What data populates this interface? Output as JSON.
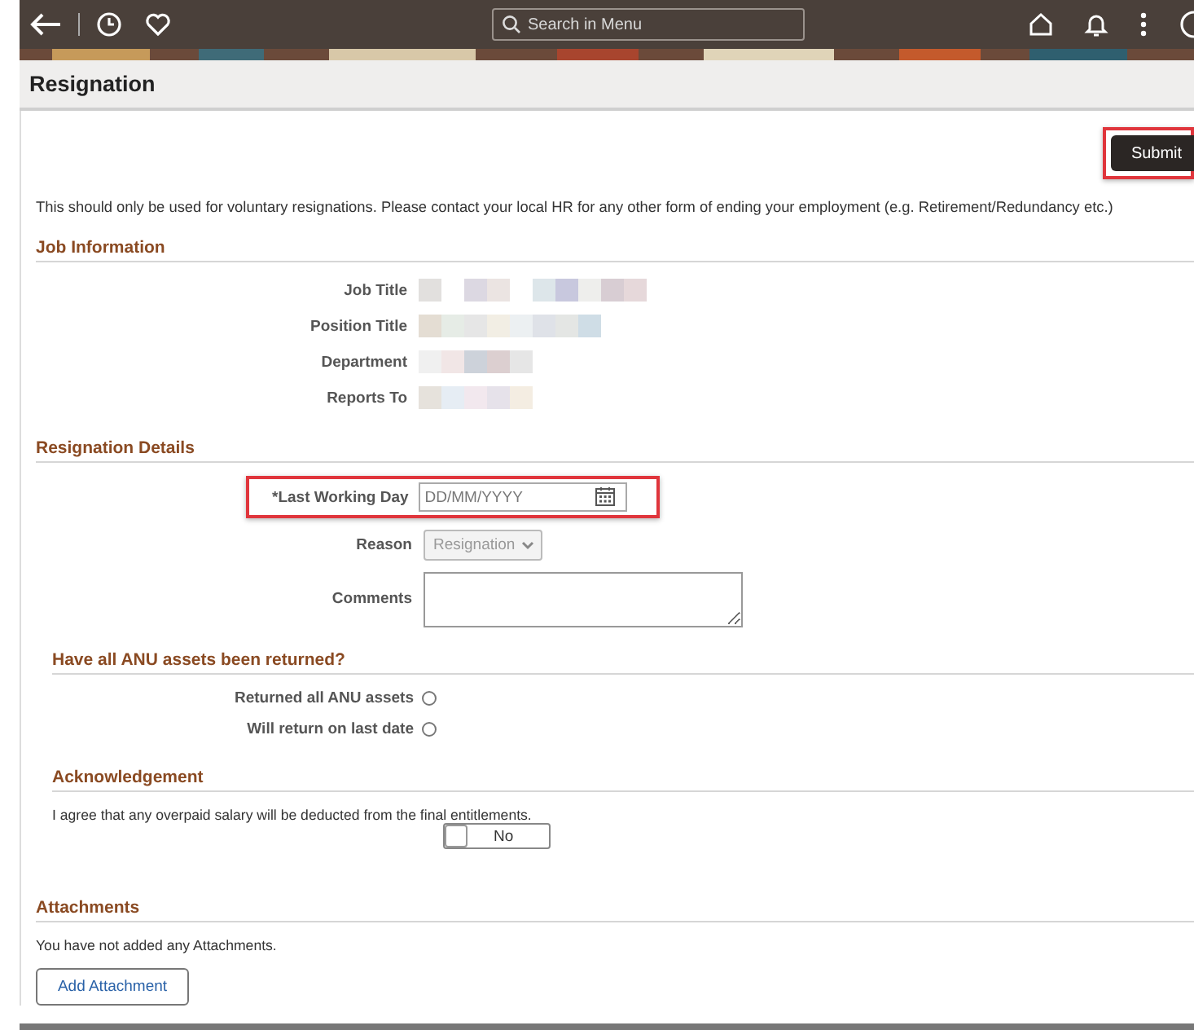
{
  "header": {
    "search": {
      "placeholder": "Search in Menu"
    }
  },
  "page_title": "Resignation",
  "submit_button": {
    "label": "Submit",
    "highlighted": true
  },
  "intro": "This should only be used for voluntary resignations. Please contact your local HR for any other form of ending your employment (e.g. Retirement/Redundancy etc.)",
  "job_information": {
    "title": "Job Information",
    "fields": [
      {
        "label": "Job Title"
      },
      {
        "label": "Position Title"
      },
      {
        "label": "Department"
      },
      {
        "label": "Reports To"
      }
    ]
  },
  "resignation_details": {
    "title": "Resignation Details",
    "last_working_day": {
      "label": "*Last Working Day",
      "placeholder": "DD/MM/YYYY",
      "highlighted": true
    },
    "reason": {
      "label": "Reason",
      "value": "Resignation",
      "disabled": true
    },
    "comments": {
      "label": "Comments"
    }
  },
  "assets": {
    "title": "Have all ANU assets been returned?",
    "options": [
      {
        "label": "Returned all ANU assets",
        "selected": false
      },
      {
        "label": "Will return on last date",
        "selected": false
      }
    ]
  },
  "acknowledgement": {
    "title": "Acknowledgement",
    "text": "I agree that any overpaid salary will be deducted from the final entitlements.",
    "toggle": {
      "label": "No",
      "on": false
    }
  },
  "attachments": {
    "title": "Attachments",
    "empty_text": "You have not added any Attachments.",
    "button": "Add Attachment"
  }
}
